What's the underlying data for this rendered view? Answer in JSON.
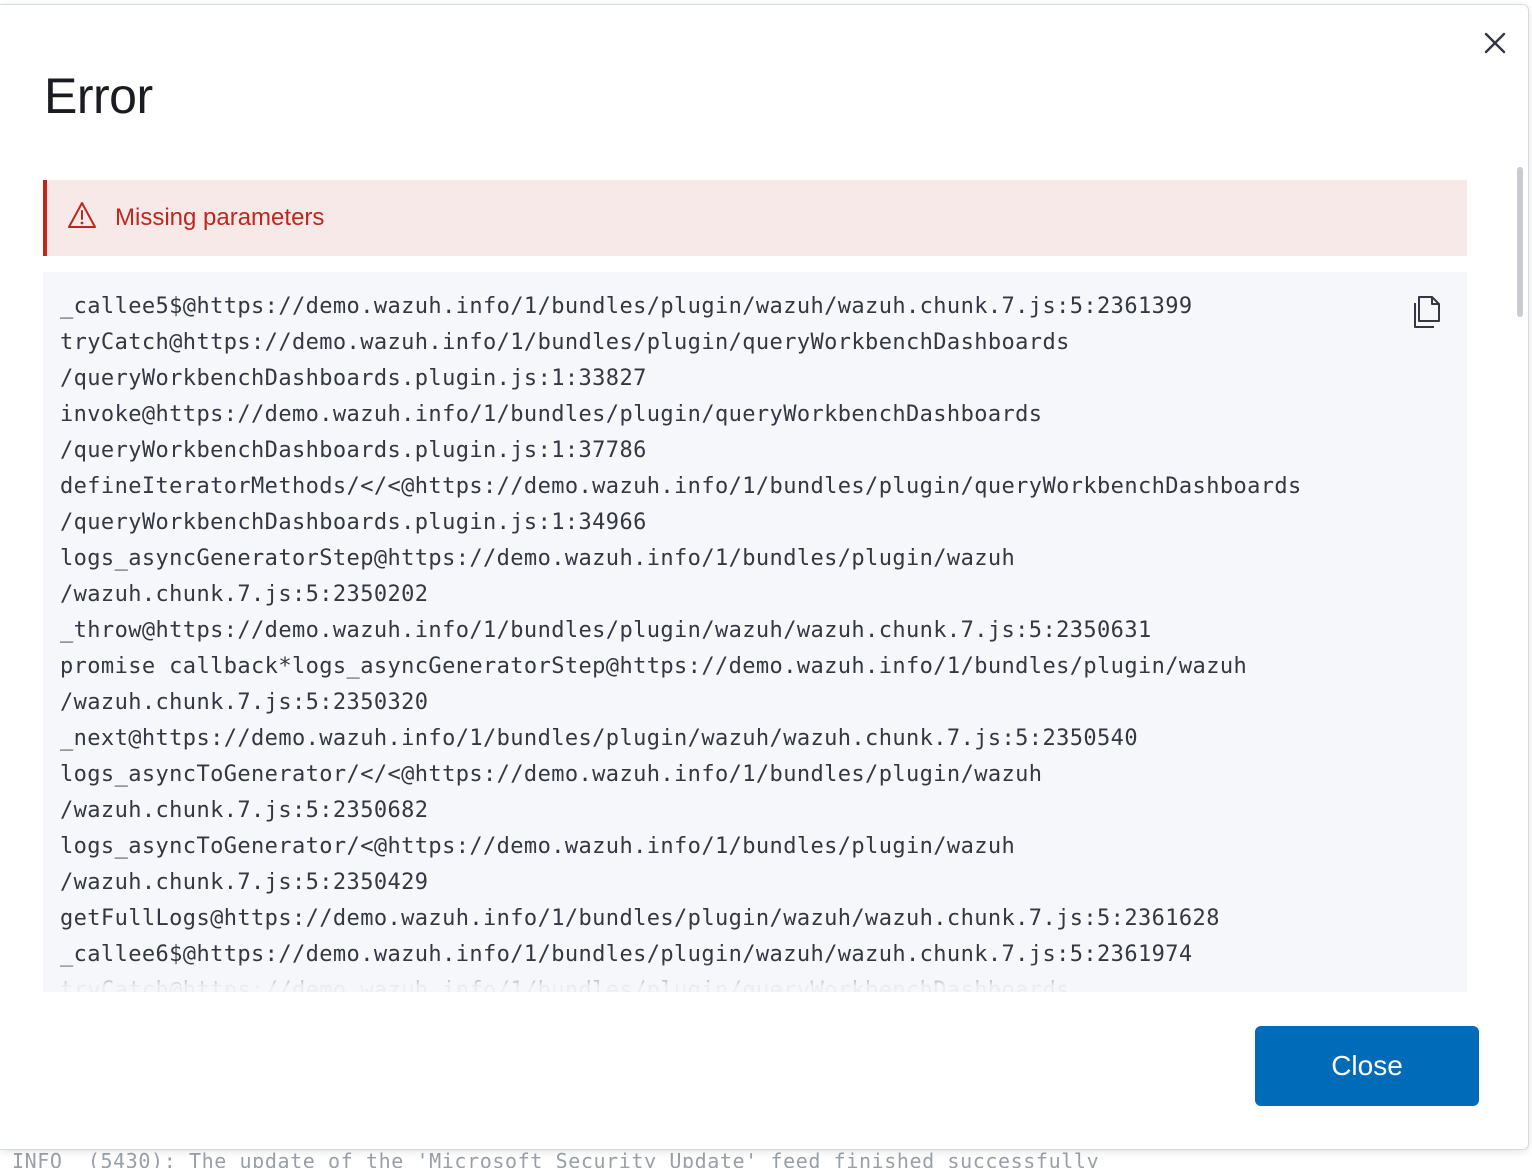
{
  "background": {
    "log_text": "INFO  (5430): The update of the 'Microsoft Security Update' feed finished successfully"
  },
  "modal": {
    "title": "Error",
    "close_icon": "close-icon",
    "callout": {
      "icon": "warning-icon",
      "text": "Missing parameters",
      "color": "#bd271e",
      "background": "#f8e9e9"
    },
    "stack_trace": {
      "copy_icon": "copy-icon",
      "lines": [
        "_callee5$@https://demo.wazuh.info/1/bundles/plugin/wazuh/wazuh.chunk.7.js:5:2361399",
        "tryCatch@https://demo.wazuh.info/1/bundles/plugin/queryWorkbenchDashboards",
        "/queryWorkbenchDashboards.plugin.js:1:33827",
        "invoke@https://demo.wazuh.info/1/bundles/plugin/queryWorkbenchDashboards",
        "/queryWorkbenchDashboards.plugin.js:1:37786",
        "defineIteratorMethods/</<@https://demo.wazuh.info/1/bundles/plugin/queryWorkbenchDashboards",
        "/queryWorkbenchDashboards.plugin.js:1:34966",
        "logs_asyncGeneratorStep@https://demo.wazuh.info/1/bundles/plugin/wazuh",
        "/wazuh.chunk.7.js:5:2350202",
        "_throw@https://demo.wazuh.info/1/bundles/plugin/wazuh/wazuh.chunk.7.js:5:2350631",
        "promise callback*logs_asyncGeneratorStep@https://demo.wazuh.info/1/bundles/plugin/wazuh",
        "/wazuh.chunk.7.js:5:2350320",
        "_next@https://demo.wazuh.info/1/bundles/plugin/wazuh/wazuh.chunk.7.js:5:2350540",
        "logs_asyncToGenerator/</<@https://demo.wazuh.info/1/bundles/plugin/wazuh",
        "/wazuh.chunk.7.js:5:2350682",
        "logs_asyncToGenerator/<@https://demo.wazuh.info/1/bundles/plugin/wazuh",
        "/wazuh.chunk.7.js:5:2350429",
        "getFullLogs@https://demo.wazuh.info/1/bundles/plugin/wazuh/wazuh.chunk.7.js:5:2361628",
        "_callee6$@https://demo.wazuh.info/1/bundles/plugin/wazuh/wazuh.chunk.7.js:5:2361974",
        "tryCatch@https://demo.wazuh.info/1/bundles/plugin/queryWorkbenchDashboards"
      ]
    },
    "footer": {
      "close_label": "Close",
      "accent": "#006bb8"
    }
  }
}
